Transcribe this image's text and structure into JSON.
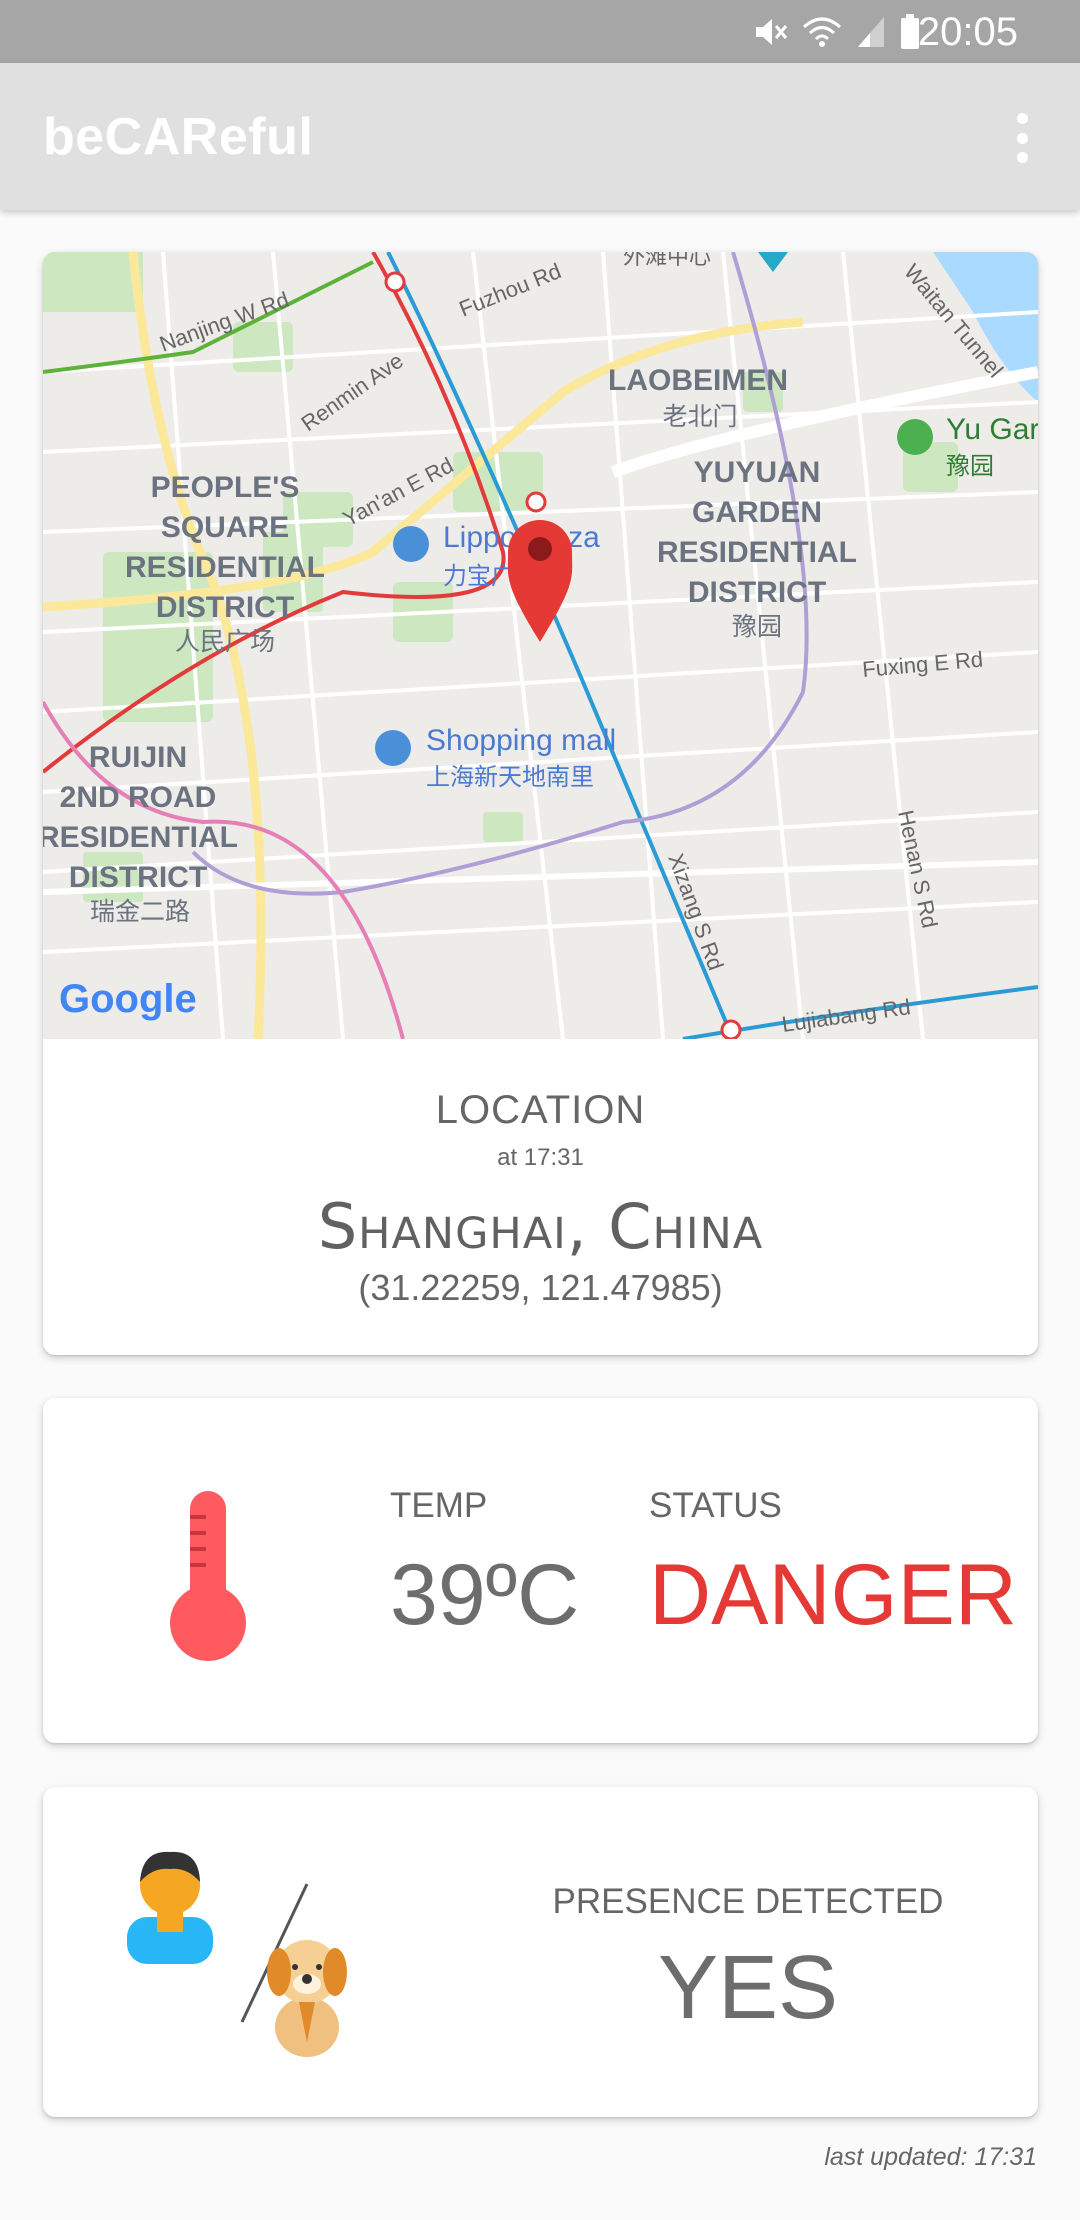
{
  "status_bar": {
    "time": "20:05",
    "icons": [
      "mute-icon",
      "wifi-icon",
      "signal-icon",
      "battery-icon"
    ]
  },
  "app_bar": {
    "title": "beCAReful",
    "menu_icon": "more-vert-icon"
  },
  "location_card": {
    "map": {
      "labels": {
        "nanjing": "Nanjing W Rd",
        "fuzhou": "Fuzhou Rd",
        "waitan": "Waitan Tunnel",
        "renmin": "Renmin Ave",
        "yanan": "Yan'an E Rd",
        "laobeimen_1": "LAOBEIMEN",
        "laobeimen_2": "老北门",
        "yugarden_en": "Yu Gar",
        "yugarden_zh": "豫园",
        "ps_1": "PEOPLE'S",
        "ps_2": "SQUARE",
        "ps_3": "RESIDENTIAL",
        "ps_4": "DISTRICT",
        "ps_5": "人民广场",
        "yy_1": "YUYUAN",
        "yy_2": "GARDEN",
        "yy_3": "RESIDENTIAL",
        "yy_4": "DISTRICT",
        "yy_5": "豫园",
        "lippo_en": "Lippo Plaza",
        "lippo_zh": "力宝广",
        "mall_en": "Shopping mall",
        "mall_zh": "上海新天地南里",
        "fuxing": "Fuxing E Rd",
        "rj_1": "RUIJIN",
        "rj_2": "2ND ROAD",
        "rj_3": "RESIDENTIAL",
        "rj_4": "DISTRICT",
        "rj_5": "瑞金二路",
        "xizang": "Xizang S Rd",
        "henan": "Henan S Rd",
        "lujiabang": "Lujiabang Rd",
        "top_cut": "外滩中心",
        "google": "Google"
      },
      "pin_icon": "map-pin-icon"
    },
    "label": "LOCATION",
    "time": "at 17:31",
    "city": "Shanghai, China",
    "coords": "(31.22259, 121.47985)"
  },
  "temperature_card": {
    "icon": "thermometer-icon",
    "temp_label": "TEMP",
    "temp_value": "39ºC",
    "status_label": "STATUS",
    "status_value": "DANGER",
    "status_color": "#e53935"
  },
  "presence_card": {
    "icons": [
      "person-icon",
      "dog-icon"
    ],
    "label": "PRESENCE DETECTED",
    "value": "YES"
  },
  "footer": {
    "last_updated": "last updated: 17:31"
  }
}
